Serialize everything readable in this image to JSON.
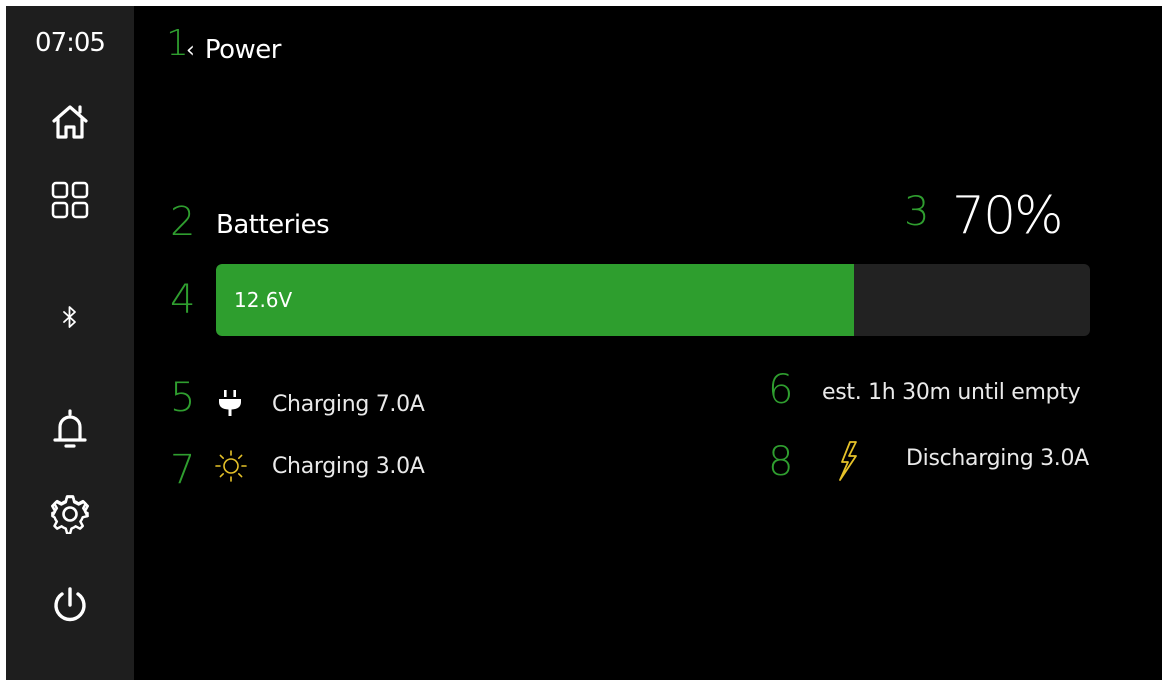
{
  "statusbar": {
    "time": "07:05"
  },
  "sidebar": {
    "items": [
      {
        "name": "home"
      },
      {
        "name": "apps"
      },
      {
        "name": "bluetooth"
      },
      {
        "name": "notifications"
      },
      {
        "name": "settings"
      },
      {
        "name": "power"
      }
    ]
  },
  "header": {
    "back_chevron": "‹",
    "title": "Power"
  },
  "markers": {
    "m1": "1",
    "m2": "2",
    "m3": "3",
    "m4": "4",
    "m5": "5",
    "m6": "6",
    "m7": "7",
    "m8": "8"
  },
  "battery": {
    "label": "Batteries",
    "percent_text": "70%",
    "level_fraction": 0.73,
    "voltage": "12.6V"
  },
  "stats": {
    "shore_power": "Charging 7.0A",
    "solar": "Charging 3.0A",
    "estimate": "est. 1h 30m until empty",
    "load": "Discharging 3.0A"
  },
  "icons": {
    "shore": "plug-icon",
    "solar": "sun-icon",
    "load": "lightning-icon"
  },
  "colors": {
    "accent": "#2e9e2e",
    "marker": "#2f9e2f",
    "solar_icon": "#e6c229",
    "load_icon": "#e6c229",
    "track": "#222222",
    "sidebar": "#1e1e1e"
  }
}
